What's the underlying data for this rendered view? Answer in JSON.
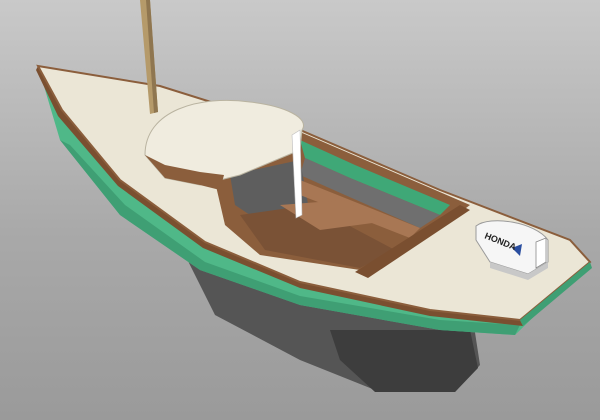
{
  "image": {
    "subject": "sailboat-3d-model",
    "colors": {
      "background_top": "#c9c9c9",
      "background_bottom": "#9a9a9a",
      "deck": "#ebe6d6",
      "hull": "#4fb888",
      "hull_shadow": "#2f7f5c",
      "wood": "#8b5e3c",
      "wood_light": "#a87754",
      "keel": "#4a4a4a",
      "cabin_top": "#f0ecdf",
      "interior_green": "#3fa877",
      "mast": "#b59a6a"
    }
  },
  "motor": {
    "brand_text": "HONDA"
  }
}
